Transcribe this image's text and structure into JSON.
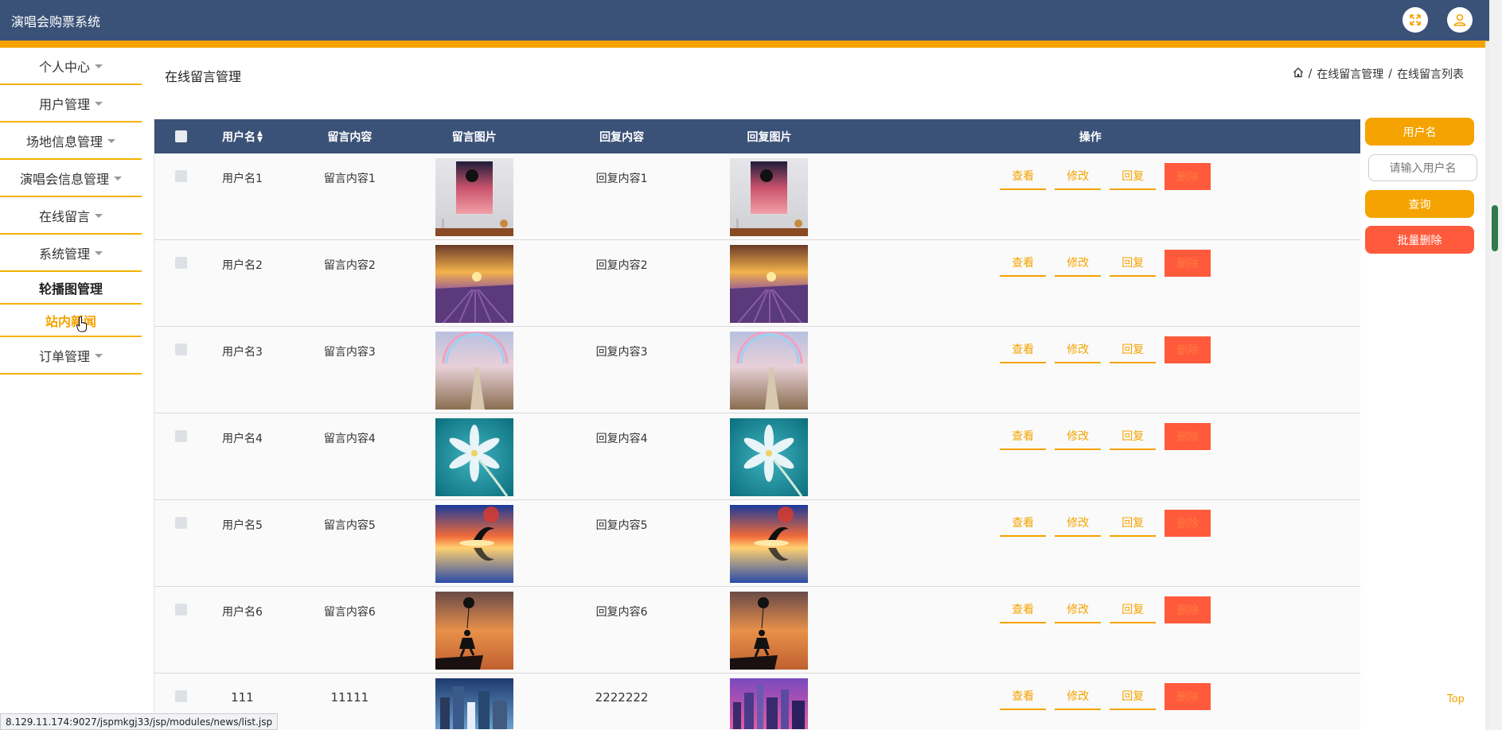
{
  "app": {
    "title": "演唱会购票系统"
  },
  "header": {
    "fullscreen_icon": "expand-icon",
    "user_icon": "user-icon"
  },
  "sidebar": {
    "items": [
      {
        "label": "个人中心",
        "caret": true
      },
      {
        "label": "用户管理",
        "caret": true
      },
      {
        "label": "场地信息管理",
        "caret": true
      },
      {
        "label": "演唱会信息管理",
        "caret": true
      },
      {
        "label": "在线留言",
        "caret": true
      },
      {
        "label": "系统管理",
        "caret": true
      },
      {
        "label": "轮播图管理",
        "caret": false
      },
      {
        "label": "站内新闻",
        "caret": false
      },
      {
        "label": "订单管理",
        "caret": true
      }
    ]
  },
  "page": {
    "title": "在线留言管理"
  },
  "breadcrumb": {
    "home_icon": "home-icon",
    "sep": "/",
    "level1": "在线留言管理",
    "level2": "在线留言列表"
  },
  "table": {
    "columns": {
      "user": "用户名",
      "msg": "留言内容",
      "img": "留言图片",
      "reply": "回复内容",
      "reply_img": "回复图片",
      "ops": "操作"
    },
    "rows": [
      {
        "user": "用户名1",
        "msg": "留言内容1",
        "reply": "回复内容1",
        "img": "painting",
        "reply_img": "painting"
      },
      {
        "user": "用户名2",
        "msg": "留言内容2",
        "reply": "回复内容2",
        "img": "lavender",
        "reply_img": "lavender"
      },
      {
        "user": "用户名3",
        "msg": "留言内容3",
        "reply": "回复内容3",
        "img": "rainbow-path",
        "reply_img": "rainbow-path"
      },
      {
        "user": "用户名4",
        "msg": "留言内容4",
        "reply": "回复内容4",
        "img": "flower",
        "reply_img": "flower"
      },
      {
        "user": "用户名5",
        "msg": "留言内容5",
        "reply": "回复内容5",
        "img": "dolphin-sunset",
        "reply_img": "dolphin-sunset"
      },
      {
        "user": "用户名6",
        "msg": "留言内容6",
        "reply": "回复内容6",
        "img": "girl-balloon",
        "reply_img": "girl-balloon"
      },
      {
        "user": "111",
        "msg": "11111",
        "reply": "2222222",
        "img": "city",
        "reply_img": "city-night"
      }
    ],
    "ops": {
      "view": "查看",
      "edit": "修改",
      "reply": "回复",
      "delete": "删除"
    }
  },
  "search": {
    "label": "用户名",
    "placeholder": "请输入用户名",
    "query": "查询",
    "batch_delete": "批量删除"
  },
  "footer": {
    "status_url": "8.129.11.174:9027/jspmkgj33/jsp/modules/news/list.jsp",
    "top": "Top"
  },
  "colors": {
    "nav": "#3b5278",
    "accent": "#f5a300",
    "danger": "#ff5a3c"
  }
}
